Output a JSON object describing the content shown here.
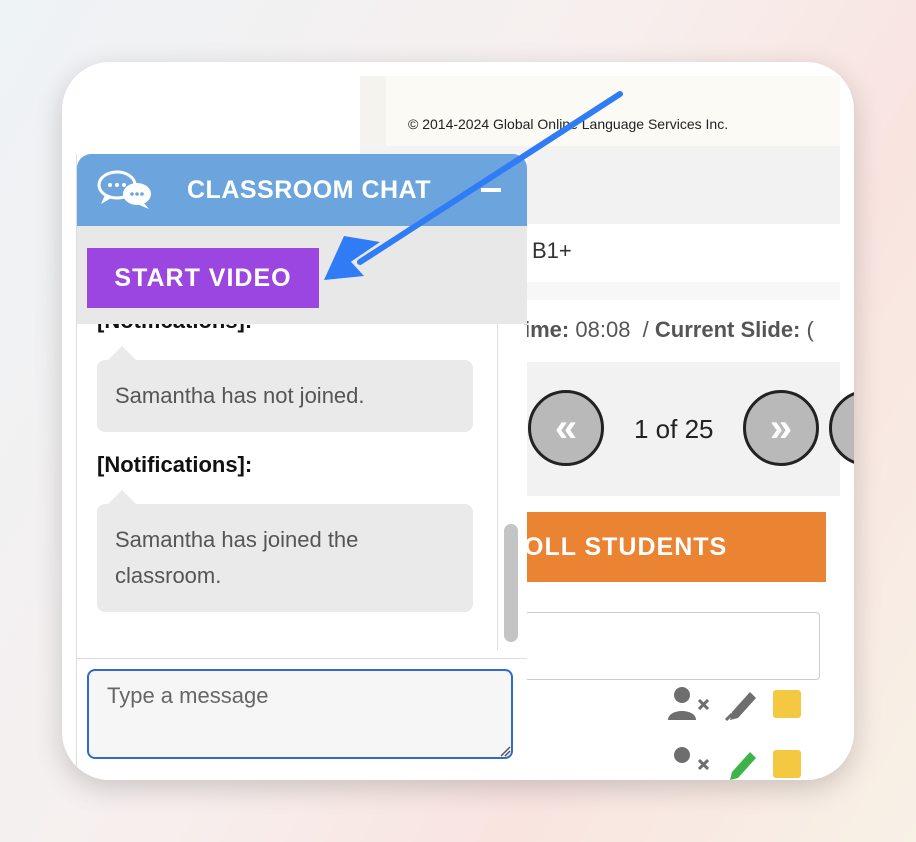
{
  "app": {
    "copyright": "© 2014-2024 Global Online Language Services Inc.",
    "level": "B1+",
    "status": {
      "time_label": "ime:",
      "time_value": "08:08",
      "separator": "/",
      "slide_label": "Current Slide:",
      "slide_value": "("
    },
    "slides": {
      "prev_glyph": "«",
      "next_glyph": "»",
      "counter": "1 of 25"
    },
    "roll_button": "OLL STUDENTS",
    "icons": [
      "user-remove-icon",
      "pen-icon",
      "sticky-note-icon"
    ]
  },
  "chat": {
    "title": "CLASSROOM CHAT",
    "header_color": "#6ca4de",
    "video_button": "START VIDEO",
    "video_button_color": "#9b46e0",
    "messages": [
      {
        "label": "[Notifications]:",
        "text": "Samantha has not joined."
      },
      {
        "label": "[Notifications]:",
        "text": "Samantha has joined the classroom."
      }
    ],
    "input_placeholder": "Type a message"
  },
  "colors": {
    "roll_button": "#ea8432",
    "annotation_arrow": "#2f7cf6"
  }
}
